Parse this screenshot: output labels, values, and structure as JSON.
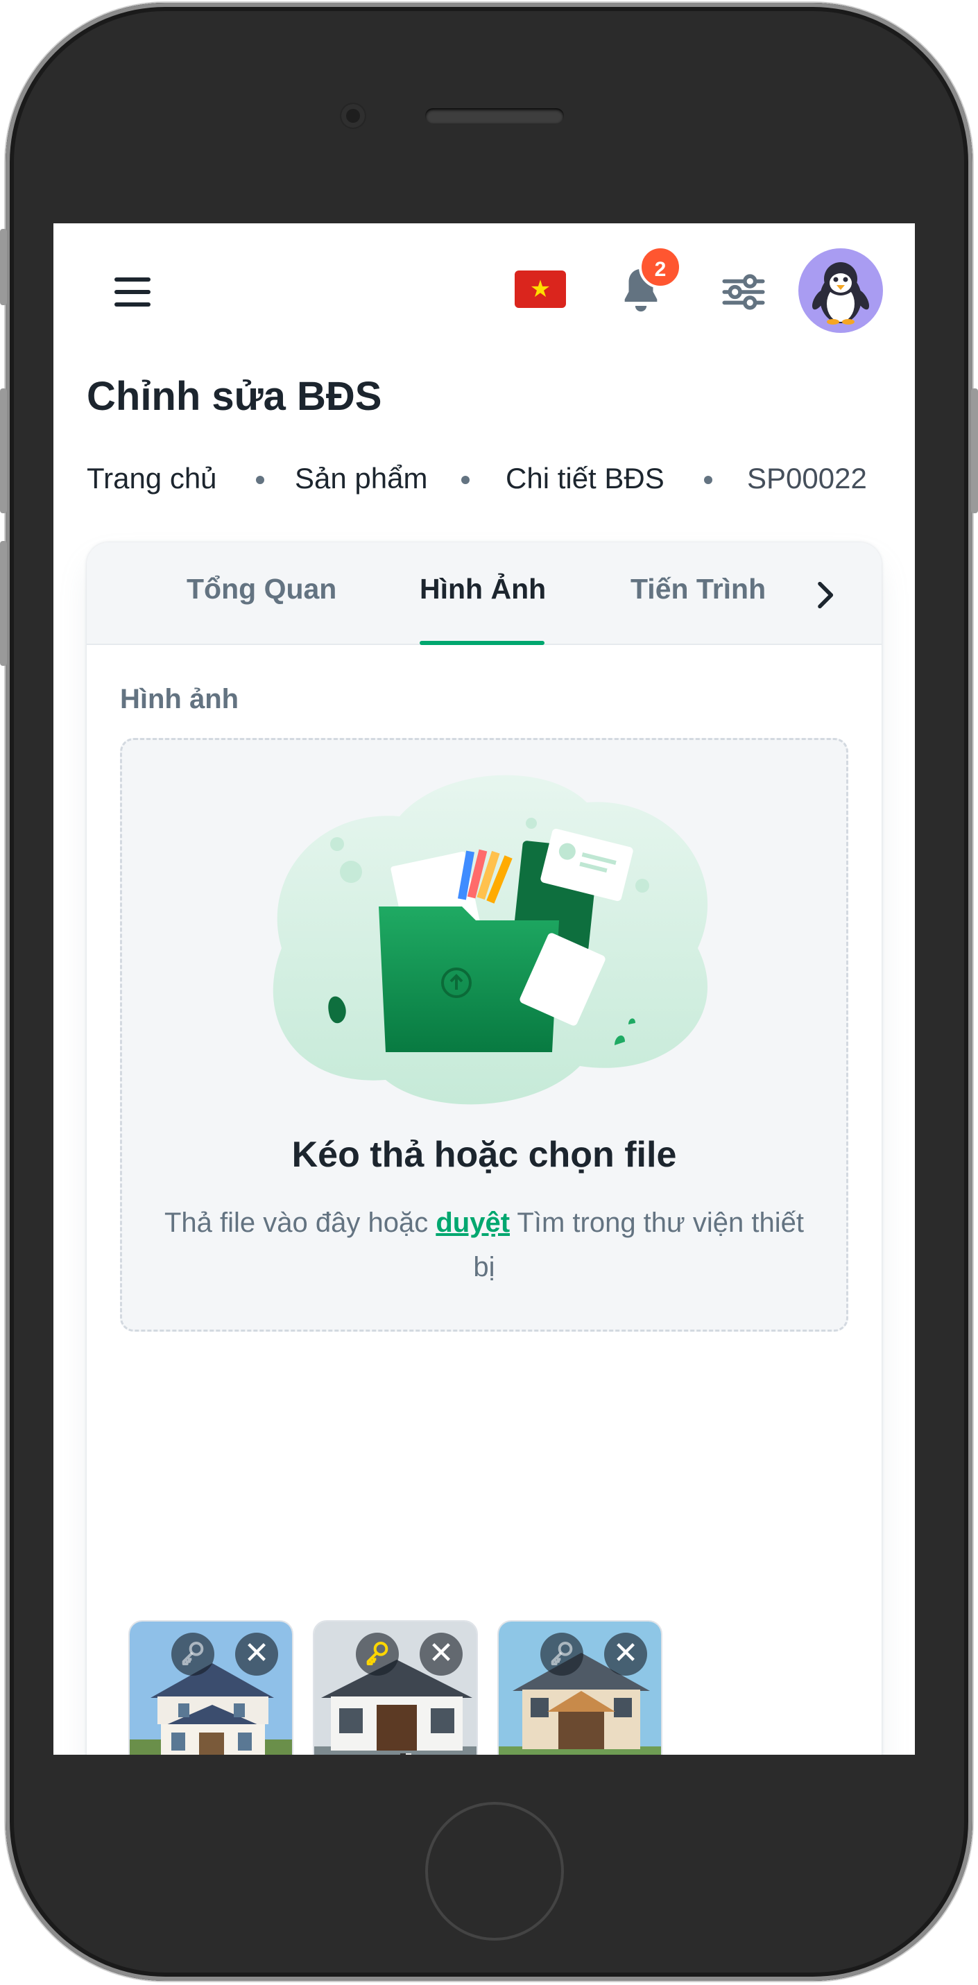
{
  "header": {
    "flag_icon": "vietnam-flag-icon",
    "notification_count": "2",
    "avatar_icon": "penguin-avatar"
  },
  "page": {
    "title": "Chỉnh sửa BĐS",
    "breadcrumb": [
      "Trang chủ",
      "Sản phẩm",
      "Chi tiết BĐS",
      "SP00022"
    ]
  },
  "tabs": [
    {
      "label": "Tổng Quan",
      "active": false
    },
    {
      "label": "Hình Ảnh",
      "active": true
    },
    {
      "label": "Tiến Trình",
      "active": false
    }
  ],
  "images_section": {
    "label": "Hình ảnh",
    "dropzone": {
      "title": "Kéo thả hoặc chọn file",
      "desc_before": "Thả file vào đây hoặc ",
      "desc_link": "duyệt",
      "desc_after": " Tìm trong thư viện thiết bị"
    },
    "thumbnails": [
      {
        "alt": "villa-1",
        "is_primary": false
      },
      {
        "alt": "house-2",
        "is_primary": true
      },
      {
        "alt": "house-3",
        "is_primary": false
      },
      {
        "alt": "villa-4",
        "is_primary": false
      }
    ]
  },
  "colors": {
    "primary": "#00a76f",
    "badge": "#ff5630",
    "key_active": "#ffd600",
    "text": "#1c252e",
    "muted": "#637381"
  }
}
